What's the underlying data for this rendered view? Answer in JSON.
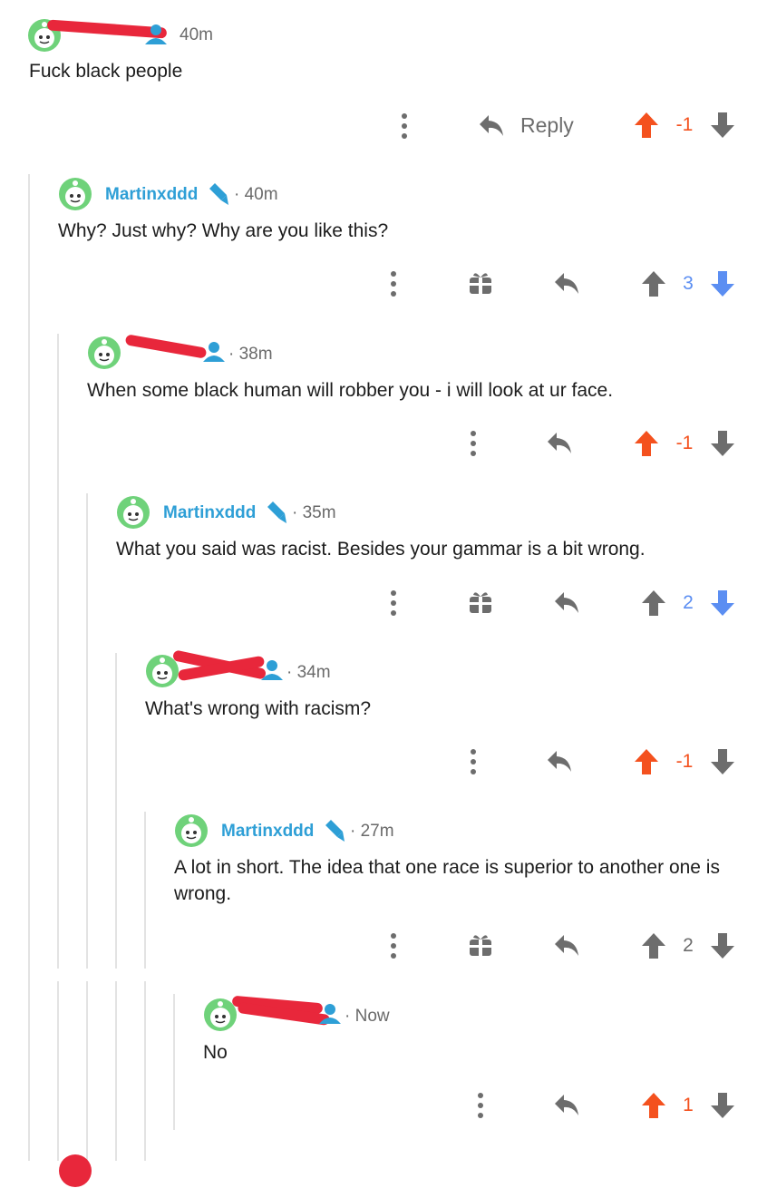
{
  "colors": {
    "accent_blue": "#2e9fd6",
    "upvote_orange": "#f4511e",
    "downvote_blue": "#5b8ef2",
    "icon_gray": "#6d6d6d",
    "redaction_red": "#e8273b"
  },
  "comments": [
    {
      "username": "",
      "time": "40m",
      "text": "Fuck black people",
      "score": "-1",
      "vote_state": "upvoted",
      "reply_label": "Reply",
      "user_icon": "user-icon"
    },
    {
      "username": "Martinxddd",
      "time": "· 40m",
      "text": "Why? Just why? Why are you like this?",
      "score": "3",
      "vote_state": "downvoted",
      "user_icon": "mod-icon"
    },
    {
      "username": "",
      "time": "· 38m",
      "text": "When some black human will robber you - i will look at ur face.",
      "score": "-1",
      "vote_state": "upvoted",
      "user_icon": "user-icon"
    },
    {
      "username": "Martinxddd",
      "time": "· 35m",
      "text": "What you said was racist. Besides your gammar is a bit wrong.",
      "score": "2",
      "vote_state": "downvoted",
      "user_icon": "mod-icon"
    },
    {
      "username": "",
      "time": "· 34m",
      "text": "What's wrong with racism?",
      "score": "-1",
      "vote_state": "upvoted",
      "user_icon": "user-icon"
    },
    {
      "username": "Martinxddd",
      "time": "· 27m",
      "text": "A lot in short. The idea that one race is superior to another one is wrong.",
      "score": "2",
      "vote_state": "none",
      "user_icon": "mod-icon"
    },
    {
      "username": "",
      "time": "· Now",
      "text": "No",
      "score": "1",
      "vote_state": "upvoted",
      "user_icon": "user-icon"
    }
  ]
}
